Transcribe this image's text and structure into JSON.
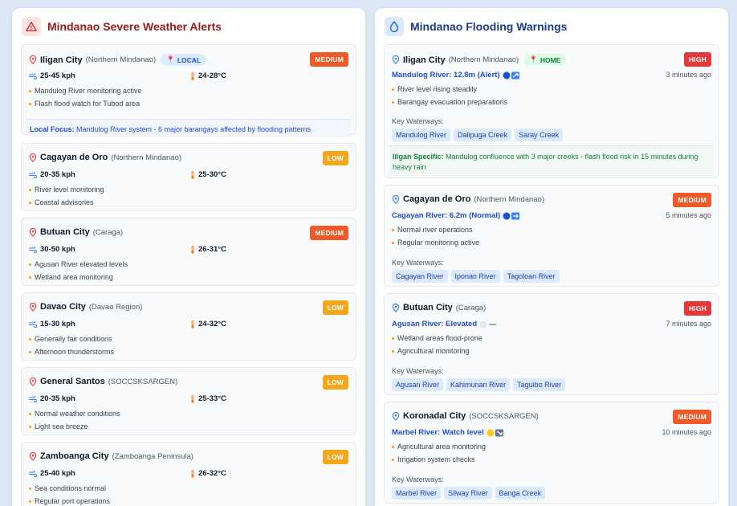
{
  "colors": {
    "medium": "#f05a28",
    "low": "#f4a61d",
    "high": "#e53939",
    "weather_title": "#991b1b",
    "flood_title": "#1e3a8a",
    "link_blue": "#1d4ed8",
    "home_green": "#15803d"
  },
  "weather": {
    "title": "Mindanao Severe Weather Alerts",
    "icon": "warning-triangle-icon",
    "cards": [
      {
        "city": "Iligan City",
        "region": "(Northern Mindanao)",
        "chip": "LOCAL",
        "level": "MEDIUM",
        "wind": "25-45 kph",
        "temp": "24-28°C",
        "notes": [
          "Mandulog River monitoring active",
          "Flash flood watch for Tubod area"
        ],
        "focus_label": "Local Focus:",
        "focus_text": " Mandulog River system - 6 major barangays affected by flooding patterns"
      },
      {
        "city": "Cagayan de Oro",
        "region": "(Northern Mindanao)",
        "level": "LOW",
        "wind": "20-35 kph",
        "temp": "25-30°C",
        "notes": [
          "River level monitoring",
          "Coastal advisories"
        ]
      },
      {
        "city": "Butuan City",
        "region": "(Caraga)",
        "level": "MEDIUM",
        "wind": "30-50 kph",
        "temp": "26-31°C",
        "notes": [
          "Agusan River elevated levels",
          "Wetland area monitoring"
        ]
      },
      {
        "city": "Davao City",
        "region": "(Davao Region)",
        "level": "LOW",
        "wind": "15-30 kph",
        "temp": "24-32°C",
        "notes": [
          "Generally fair conditions",
          "Afternoon thunderstorms"
        ]
      },
      {
        "city": "General Santos",
        "region": "(SOCCSKSARGEN)",
        "level": "LOW",
        "wind": "20-35 kph",
        "temp": "25-33°C",
        "notes": [
          "Normal weather conditions",
          "Light sea breeze"
        ]
      },
      {
        "city": "Zamboanga City",
        "region": "(Zamboanga Peninsula)",
        "level": "LOW",
        "wind": "25-40 kph",
        "temp": "26-32°C",
        "notes": [
          "Sea conditions normal",
          "Regular port operations"
        ]
      }
    ]
  },
  "flood": {
    "title": "Mindanao Flooding Warnings",
    "icon": "water-drop-icon",
    "waterways_label": "Key Waterways:",
    "cards": [
      {
        "city": "Iligan City",
        "region": "(Northern Mindanao)",
        "chip": "HOME",
        "level": "HIGH",
        "river": "Mandulog River: 12.8m (Alert)",
        "time": "3 minutes ago",
        "notes": [
          "River level rising steadily",
          "Barangay evacuation preparations"
        ],
        "waterways": [
          "Mandulog River",
          "Dalipuga Creek",
          "Saray Creek"
        ],
        "specific_label": "Iligan Specific:",
        "specific_text": " Mandulog confluence with 3 major creeks - flash flood risk in 15 minutes during heavy rain"
      },
      {
        "city": "Cagayan de Oro",
        "region": "(Northern Mindanao)",
        "level": "MEDIUM",
        "river": "Cagayan River: 6.2m (Normal)",
        "time": "5 minutes ago",
        "notes": [
          "Normal river operations",
          "Regular monitoring active"
        ],
        "waterways": [
          "Cagayan River",
          "Iponan River",
          "Tagoloan River"
        ]
      },
      {
        "city": "Butuan City",
        "region": "(Caraga)",
        "level": "HIGH",
        "river": "Agusan River: Elevated",
        "time": "7 minutes ago",
        "notes": [
          "Wetland areas flood-prone",
          "Agricultural monitoring"
        ],
        "waterways": [
          "Agusan River",
          "Kahimunan River",
          "Taguibo River"
        ]
      },
      {
        "city": "Koronadal City",
        "region": "(SOCCSKSARGEN)",
        "level": "MEDIUM",
        "river": "Marbel River: Watch level",
        "time": "10 minutes ago",
        "notes": [
          "Agricultural area monitoring",
          "Irrigation system checks"
        ],
        "waterways": [
          "Marbel River",
          "Silway River",
          "Banga Creek"
        ]
      }
    ]
  }
}
